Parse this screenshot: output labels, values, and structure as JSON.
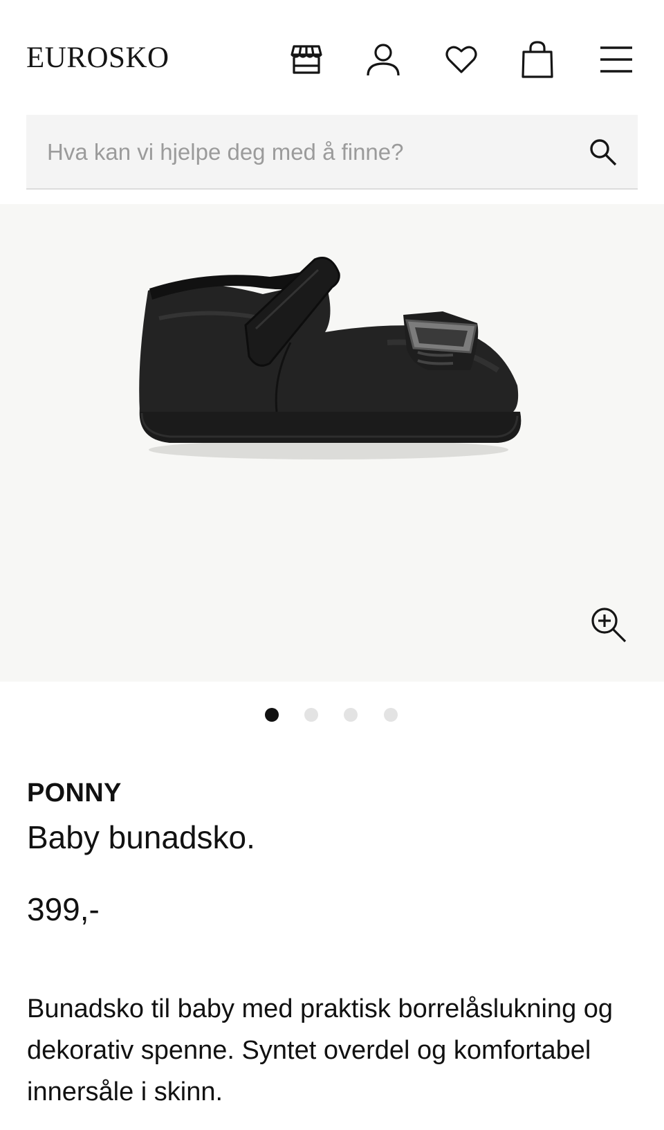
{
  "header": {
    "logo": "EUROSKO",
    "icons": [
      "store-icon",
      "user-icon",
      "heart-icon",
      "bag-icon",
      "menu-icon"
    ]
  },
  "search": {
    "placeholder": "Hva kan vi hjelpe deg med å finne?",
    "value": ""
  },
  "gallery": {
    "image_count": 4,
    "active_index": 0,
    "background": "#f7f7f5"
  },
  "product": {
    "brand": "PONNY",
    "name": "Baby bunadsko.",
    "price": "399,-",
    "description": "Bunadsko til baby med praktisk borrelåslukning og dekorativ spenne. Syntet overdel og komfortabel innersåle i skinn."
  }
}
